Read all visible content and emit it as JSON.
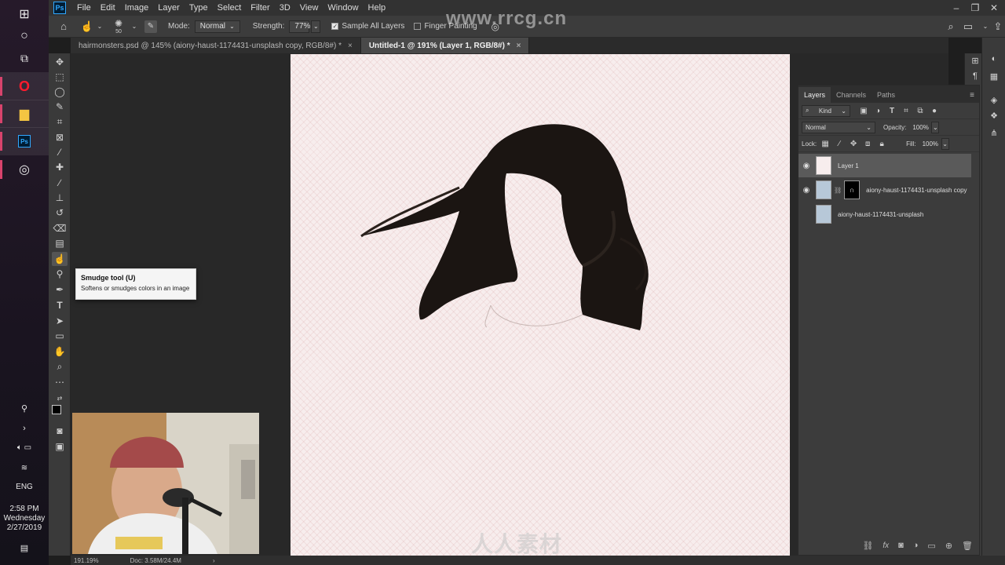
{
  "watermark": {
    "site": "www.rrcg.cn",
    "brand": "人人素材"
  },
  "taskbar": {
    "apps": [
      {
        "name": "start-icon",
        "glyph": "⊞"
      },
      {
        "name": "cortana-icon",
        "glyph": "○"
      },
      {
        "name": "task-view-icon",
        "glyph": "⧉"
      },
      {
        "name": "opera-icon",
        "glyph": "O"
      },
      {
        "name": "file-explorer-icon",
        "glyph": "▆"
      },
      {
        "name": "photoshop-icon",
        "glyph": "Ps"
      },
      {
        "name": "app-icon",
        "glyph": "◎"
      }
    ],
    "language": "ENG",
    "time": "2:58 PM",
    "day": "Wednesday",
    "date": "2/27/2019"
  },
  "menubar": {
    "logo": "Ps",
    "items": [
      "File",
      "Edit",
      "Image",
      "Layer",
      "Type",
      "Select",
      "Filter",
      "3D",
      "View",
      "Window",
      "Help"
    ]
  },
  "options": {
    "brush_size": "50",
    "mode_label": "Mode:",
    "mode_value": "Normal",
    "strength_label": "Strength:",
    "strength_value": "77%",
    "sample_all_layers": "Sample All Layers",
    "finger_painting": "Finger Painting"
  },
  "tabs": [
    {
      "label": "hairmonsters.psd @ 145% (aiony-haust-1174431-unsplash copy, RGB/8#) *",
      "close": "×"
    },
    {
      "label": "Untitled-1 @ 191% (Layer 1, RGB/8#) *",
      "close": "×"
    }
  ],
  "tooltip": {
    "title": "Smudge tool (U)",
    "description": "Softens or smudges colors in an image"
  },
  "layers_panel": {
    "tabs": [
      "Layers",
      "Channels",
      "Paths"
    ],
    "filter_kind": "Kind",
    "blend_mode": "Normal",
    "opacity_label": "Opacity:",
    "opacity_value": "100%",
    "lock_label": "Lock:",
    "fill_label": "Fill:",
    "fill_value": "100%",
    "layers": [
      {
        "name": "Layer 1",
        "visible": true,
        "selected": true
      },
      {
        "name": "aiony-haust-1174431-unsplash copy",
        "visible": true,
        "selected": false
      },
      {
        "name": "aiony-haust-1174431-unsplash",
        "visible": false,
        "selected": false
      }
    ],
    "footer_icons": [
      "link-icon",
      "fx-icon",
      "mask-icon",
      "adjustment-icon",
      "folder-icon",
      "new-layer-icon",
      "trash-icon"
    ],
    "fx_label": "fx"
  },
  "status": {
    "zoom": "191.19%",
    "doc": "Doc: 3.58M/24.4M"
  }
}
